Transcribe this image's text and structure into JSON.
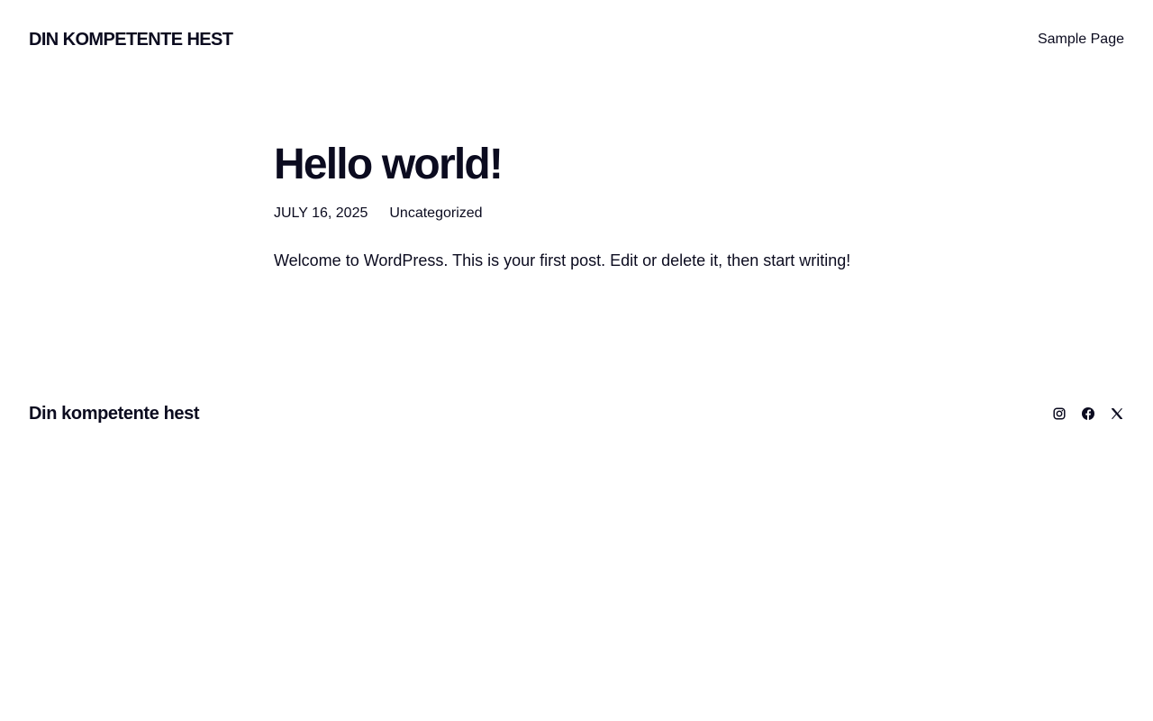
{
  "header": {
    "site_title": "DIN KOMPETENTE HEST",
    "nav": [
      {
        "label": "Sample Page"
      }
    ]
  },
  "post": {
    "title": "Hello world!",
    "date": "JULY 16, 2025",
    "category": "Uncategorized",
    "content": "Welcome to WordPress. This is your first post. Edit or delete it, then start writing!"
  },
  "footer": {
    "site_title": "Din kompetente hest",
    "social_icons": [
      "instagram-icon",
      "facebook-icon",
      "x-icon"
    ]
  },
  "colors": {
    "text": "#0b0b1f",
    "background": "#ffffff"
  }
}
